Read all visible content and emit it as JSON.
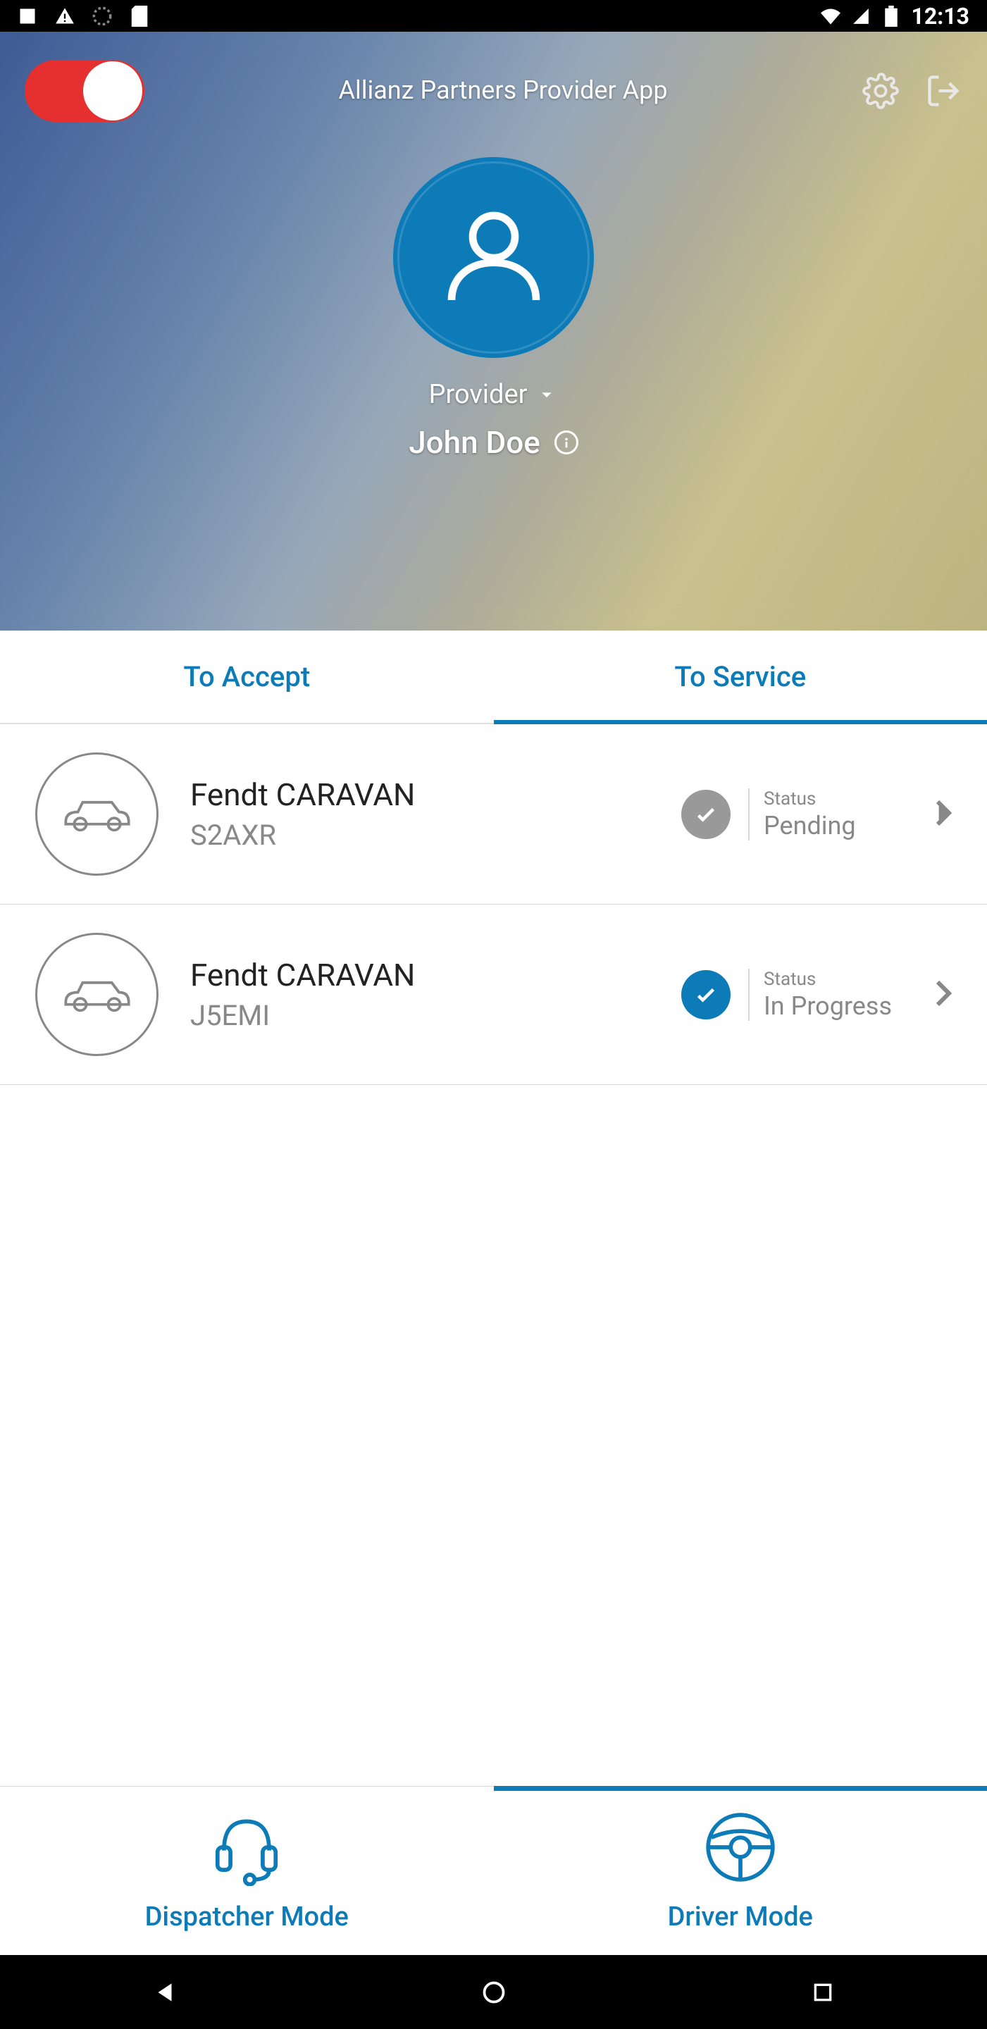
{
  "status_bar": {
    "time": "12:13"
  },
  "header": {
    "app_title": "Allianz Partners Provider App",
    "role": "Provider",
    "user_name": "John Doe"
  },
  "tabs": {
    "to_accept": "To Accept",
    "to_service": "To Service",
    "active_index": 1
  },
  "list": [
    {
      "vehicle": "Fendt CARAVAN",
      "code": "S2AXR",
      "status_label": "Status",
      "status_value": "Pending",
      "active": false
    },
    {
      "vehicle": "Fendt CARAVAN",
      "code": "J5EMI",
      "status_label": "Status",
      "status_value": "In Progress",
      "active": true
    }
  ],
  "bottom_tabs": {
    "dispatcher": "Dispatcher Mode",
    "driver": "Driver Mode",
    "active_index": 1
  },
  "colors": {
    "primary": "#0d7bb8",
    "toggle_off": "#e63030",
    "muted": "#888"
  }
}
